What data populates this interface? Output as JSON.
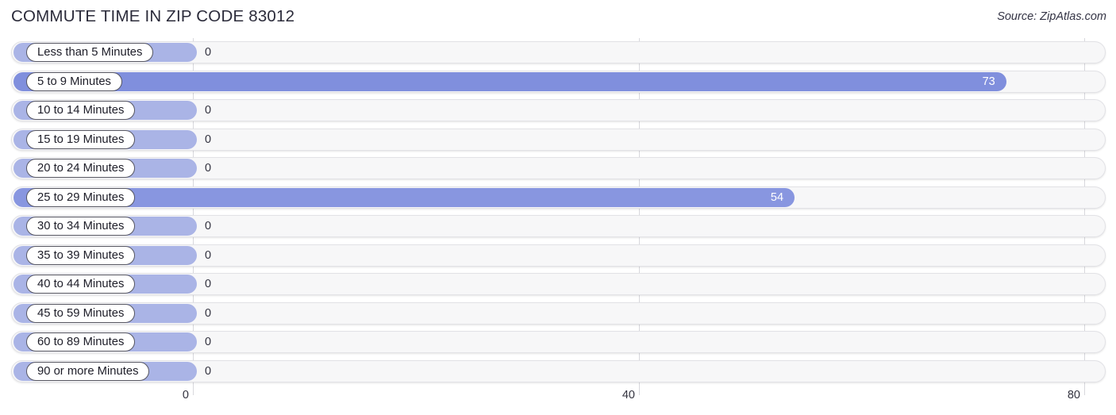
{
  "header": {
    "title": "COMMUTE TIME IN ZIP CODE 83012",
    "source": "Source: ZipAtlas.com"
  },
  "colors": {
    "bar_light": "#aab4e6",
    "bar_dark": "#808fdd",
    "bar_mid": "#8896e0",
    "track_fill": "#f7f7f8",
    "track_border": "#e2e2e6",
    "gridline": "#d8d8dd",
    "title_text": "#2b2b3a",
    "label_text": "#1d1d28"
  },
  "chart_data": {
    "type": "bar",
    "orientation": "horizontal",
    "title": "COMMUTE TIME IN ZIP CODE 83012",
    "xlabel": "",
    "ylabel": "",
    "xlim": [
      0,
      80
    ],
    "xticks": [
      0,
      40,
      80
    ],
    "xtick_labels": [
      "0",
      "40",
      "80"
    ],
    "grid": true,
    "legend": null,
    "categories": [
      "Less than 5 Minutes",
      "5 to 9 Minutes",
      "10 to 14 Minutes",
      "15 to 19 Minutes",
      "20 to 24 Minutes",
      "25 to 29 Minutes",
      "30 to 34 Minutes",
      "35 to 39 Minutes",
      "40 to 44 Minutes",
      "45 to 59 Minutes",
      "60 to 89 Minutes",
      "90 or more Minutes"
    ],
    "values": [
      0,
      73,
      0,
      0,
      0,
      54,
      0,
      0,
      0,
      0,
      0,
      0
    ],
    "value_labels": [
      "0",
      "73",
      "0",
      "0",
      "0",
      "54",
      "0",
      "0",
      "0",
      "0",
      "0",
      "0"
    ]
  },
  "rows": [
    {
      "label": "Less than 5 Minutes",
      "value": 0,
      "value_label": "0",
      "tone": "light"
    },
    {
      "label": "5 to 9 Minutes",
      "value": 73,
      "value_label": "73",
      "tone": "dark"
    },
    {
      "label": "10 to 14 Minutes",
      "value": 0,
      "value_label": "0",
      "tone": "light"
    },
    {
      "label": "15 to 19 Minutes",
      "value": 0,
      "value_label": "0",
      "tone": "light"
    },
    {
      "label": "20 to 24 Minutes",
      "value": 0,
      "value_label": "0",
      "tone": "light"
    },
    {
      "label": "25 to 29 Minutes",
      "value": 54,
      "value_label": "54",
      "tone": "mid"
    },
    {
      "label": "30 to 34 Minutes",
      "value": 0,
      "value_label": "0",
      "tone": "light"
    },
    {
      "label": "35 to 39 Minutes",
      "value": 0,
      "value_label": "0",
      "tone": "light"
    },
    {
      "label": "40 to 44 Minutes",
      "value": 0,
      "value_label": "0",
      "tone": "light"
    },
    {
      "label": "45 to 59 Minutes",
      "value": 0,
      "value_label": "0",
      "tone": "light"
    },
    {
      "label": "60 to 89 Minutes",
      "value": 0,
      "value_label": "0",
      "tone": "light"
    },
    {
      "label": "90 or more Minutes",
      "value": 0,
      "value_label": "0",
      "tone": "light"
    }
  ],
  "axis": {
    "ticks": [
      {
        "label": "0",
        "value": 0
      },
      {
        "label": "40",
        "value": 40
      },
      {
        "label": "80",
        "value": 80
      }
    ]
  }
}
